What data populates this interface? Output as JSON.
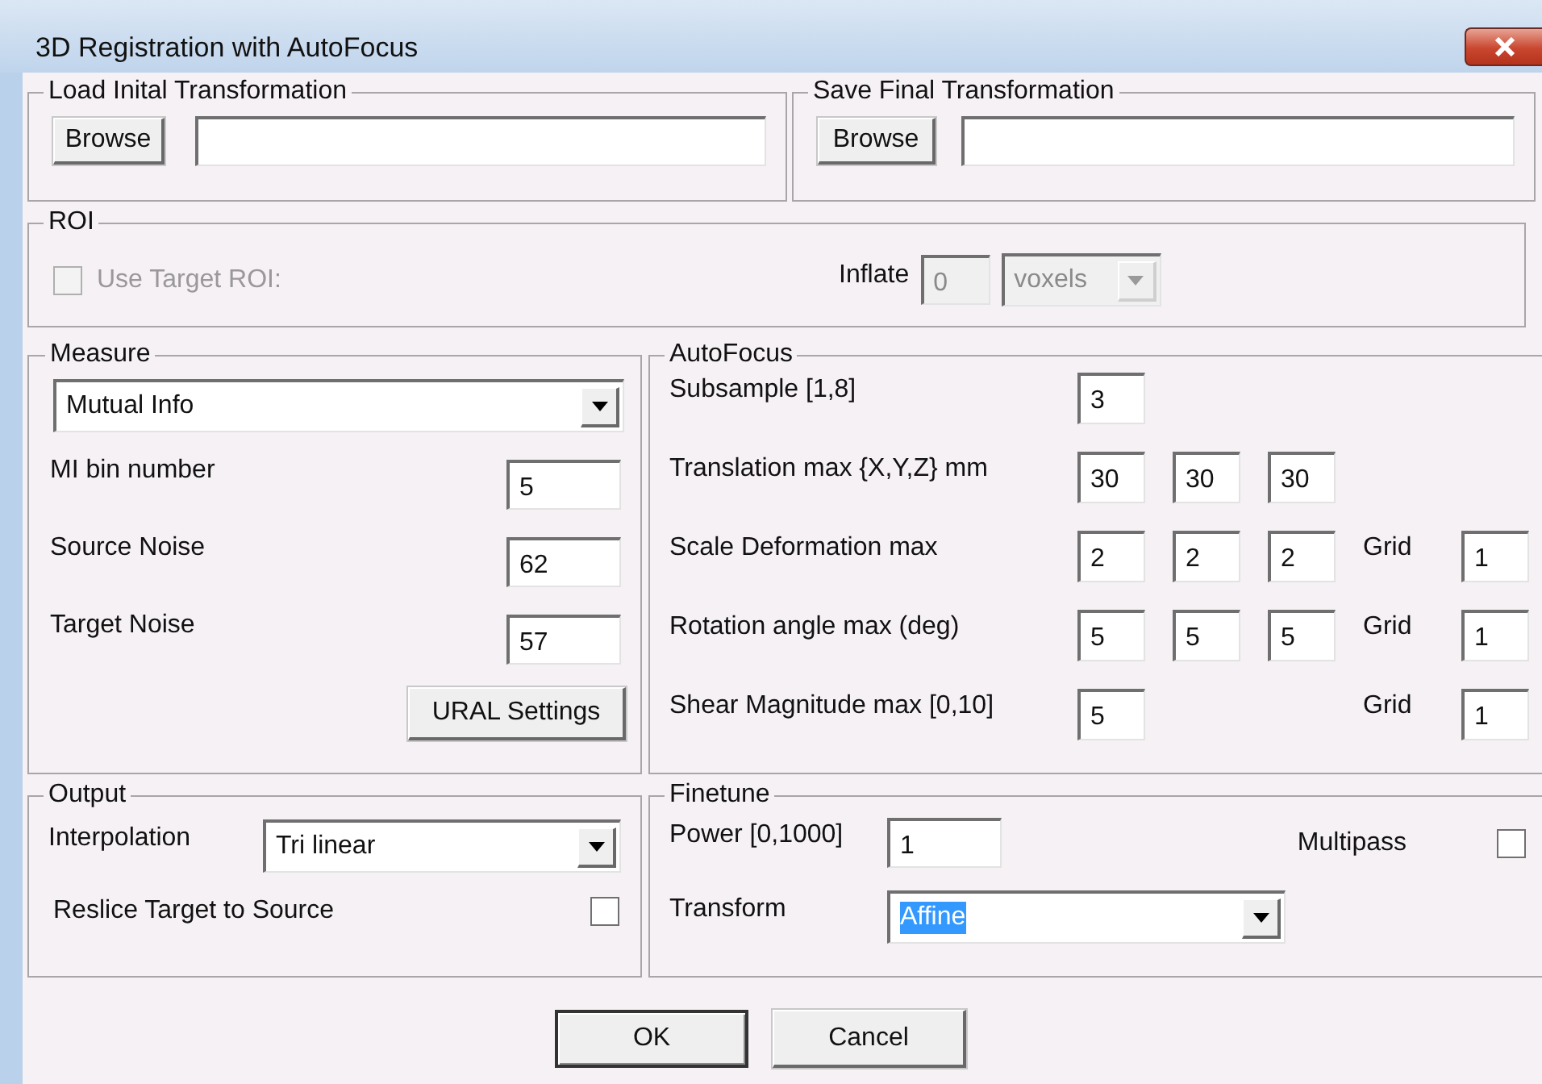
{
  "window": {
    "title": "3D Registration with AutoFocus"
  },
  "load_group": {
    "legend": "Load Inital Transformation",
    "button": "Browse"
  },
  "save_group": {
    "legend": "Save Final Transformation",
    "button": "Browse"
  },
  "roi": {
    "legend": "ROI",
    "use_target_roi": {
      "label": "Use Target ROI:",
      "checked": false,
      "disabled": true
    },
    "inflate": {
      "label": "Inflate",
      "value": "0",
      "disabled": true
    },
    "unit": {
      "value": "voxels",
      "disabled": true
    }
  },
  "measure": {
    "legend": "Measure",
    "metric": "Mutual Info",
    "rows": [
      {
        "label": "MI bin number",
        "value": "5"
      },
      {
        "label": "Source Noise",
        "value": "62"
      },
      {
        "label": "Target Noise",
        "value": "57"
      }
    ],
    "button": "URAL Settings"
  },
  "autofocus": {
    "legend": "AutoFocus",
    "rows": [
      {
        "label": "Subsample [1,8]",
        "values": [
          "3"
        ]
      },
      {
        "label": "Translation max {X,Y,Z} mm",
        "values": [
          "30",
          "30",
          "30"
        ]
      },
      {
        "label": "Scale Deformation max",
        "values": [
          "2",
          "2",
          "2"
        ],
        "grid_label": "Grid",
        "grid": "1"
      },
      {
        "label": "Rotation angle max (deg)",
        "values": [
          "5",
          "5",
          "5"
        ],
        "grid_label": "Grid",
        "grid": "1"
      },
      {
        "label": "Shear Magnitude max [0,10]",
        "values": [
          "5"
        ],
        "grid_label": "Grid",
        "grid": "1"
      }
    ]
  },
  "output": {
    "legend": "Output",
    "interpolation": {
      "label": "Interpolation",
      "value": "Tri linear"
    },
    "reslice": {
      "label": "Reslice Target to Source",
      "checked": false
    }
  },
  "finetune": {
    "legend": "Finetune",
    "power": {
      "label": "Power [0,1000]",
      "value": "1"
    },
    "multipass": {
      "label": "Multipass",
      "checked": false
    },
    "transform": {
      "label": "Transform",
      "value": "Affine",
      "highlighted": true
    }
  },
  "buttons": [
    {
      "label": "OK",
      "default": true
    },
    {
      "label": "Cancel",
      "default": false
    }
  ]
}
